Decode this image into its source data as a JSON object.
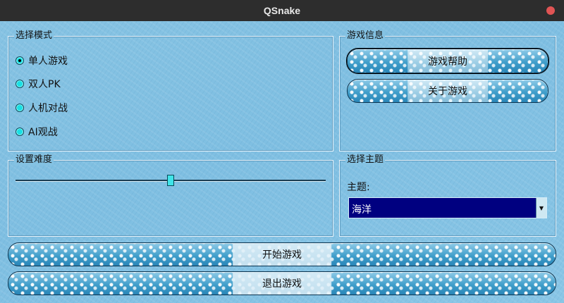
{
  "window": {
    "title": "QSnake"
  },
  "mode_group": {
    "title": "选择模式",
    "options": [
      {
        "label": "单人游戏",
        "checked": true
      },
      {
        "label": "双人PK",
        "checked": false
      },
      {
        "label": "人机对战",
        "checked": false
      },
      {
        "label": "AI观战",
        "checked": false
      }
    ]
  },
  "info_group": {
    "title": "游戏信息",
    "help_label": "游戏帮助",
    "about_label": "关于游戏"
  },
  "difficulty_group": {
    "title": "设置难度",
    "level_fraction": 0.5
  },
  "theme_group": {
    "title": "选择主题",
    "label": "主题:",
    "selected": "海洋"
  },
  "actions": {
    "start_label": "开始游戏",
    "exit_label": "退出游戏"
  },
  "colors": {
    "titlebar": "#2d2d2d",
    "close": "#e05454",
    "background": "#84c2e3",
    "combo_bg": "#000080",
    "radio": "#18e0e4"
  }
}
